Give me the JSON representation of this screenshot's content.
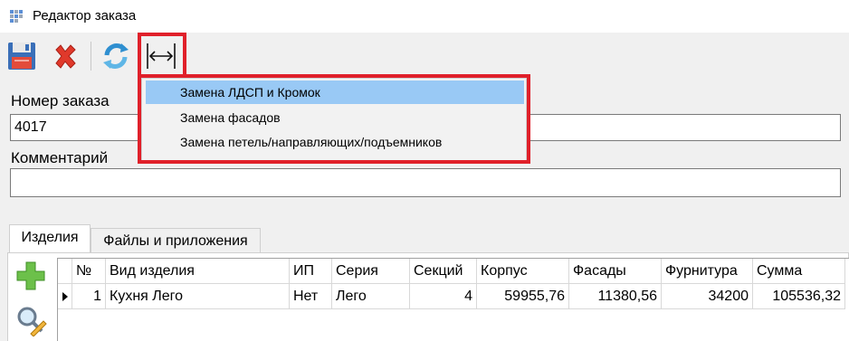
{
  "window": {
    "title": "Редактор заказа",
    "app_icon": "grid-app-icon"
  },
  "toolbar": {
    "buttons": [
      {
        "name": "save-button",
        "icon": "floppy-disk-icon"
      },
      {
        "name": "delete-button",
        "icon": "red-x-icon"
      },
      {
        "name": "refresh-button",
        "icon": "refresh-arrows-icon"
      },
      {
        "name": "replace-button",
        "icon": "horizontal-arrows-icon"
      }
    ]
  },
  "replace_menu": {
    "items": [
      {
        "label": "Замена ЛДСП и Кромок",
        "selected": true
      },
      {
        "label": "Замена фасадов",
        "selected": false
      },
      {
        "label": "Замена петель/направляющих/подъемников",
        "selected": false
      }
    ]
  },
  "form": {
    "order_number_label": "Номер заказа",
    "order_number_value": "4017",
    "comment_label": "Комментарий",
    "comment_value": ""
  },
  "tabs": [
    {
      "label": "Изделия",
      "active": true
    },
    {
      "label": "Файлы и приложения",
      "active": false
    }
  ],
  "table": {
    "columns": [
      "№",
      "Вид изделия",
      "ИП",
      "Серия",
      "Секций",
      "Корпус",
      "Фасады",
      "Фурнитура",
      "Сумма"
    ],
    "rows": [
      {
        "current": true,
        "cells": [
          "1",
          "Кухня Лего",
          "Нет",
          "Лего",
          "4",
          "59955,76",
          "11380,56",
          "34200",
          "105536,32"
        ]
      }
    ]
  },
  "colors": {
    "highlight": "#e0202a",
    "selection": "#99c9f5"
  }
}
